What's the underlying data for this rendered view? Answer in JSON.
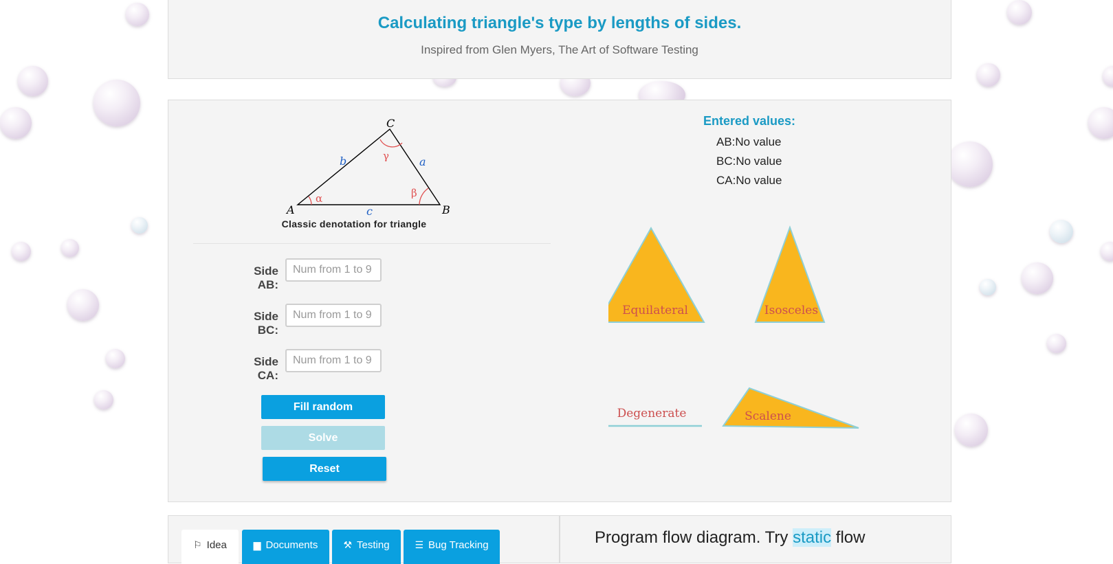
{
  "header": {
    "title": "Calculating triangle's type by lengths of sides.",
    "subtitle": "Inspired from Glen Myers, The Art of Software Testing"
  },
  "diagram": {
    "vertices": [
      "A",
      "B",
      "C"
    ],
    "sides": [
      "a",
      "b",
      "c"
    ],
    "angles": [
      "α",
      "β",
      "γ"
    ],
    "caption": "Classic denotation for triangle"
  },
  "form": {
    "fields": [
      {
        "label": "Side AB:",
        "placeholder": "Num from 1 to 9",
        "value": ""
      },
      {
        "label": "Side BC:",
        "placeholder": "Num from 1 to 9",
        "value": ""
      },
      {
        "label": "Side CA:",
        "placeholder": "Num from 1 to 9",
        "value": ""
      }
    ],
    "buttons": {
      "fill_random": "Fill random",
      "solve": "Solve",
      "reset": "Reset"
    }
  },
  "entered": {
    "heading": "Entered values:",
    "lines": [
      "AB:No value",
      "BC:No value",
      "CA:No value"
    ]
  },
  "types": [
    "Equilateral",
    "Isosceles",
    "Degenerate",
    "Scalene"
  ],
  "tabs": [
    {
      "label": "Idea",
      "icon": "flag-icon",
      "active": true
    },
    {
      "label": "Documents",
      "icon": "document-icon",
      "active": false
    },
    {
      "label": "Testing",
      "icon": "wrench-icon",
      "active": false
    },
    {
      "label": "Bug Tracking",
      "icon": "list-icon",
      "active": false
    }
  ],
  "flow": {
    "prefix": "Program flow diagram. Try ",
    "link": "static",
    "suffix": " flow"
  },
  "colors": {
    "accent": "#1a9ac4",
    "button": "#0aa0e0",
    "button_disabled": "#addbe5",
    "triangle_fill": "#f9b61e",
    "triangle_label": "#cc4f4f"
  }
}
